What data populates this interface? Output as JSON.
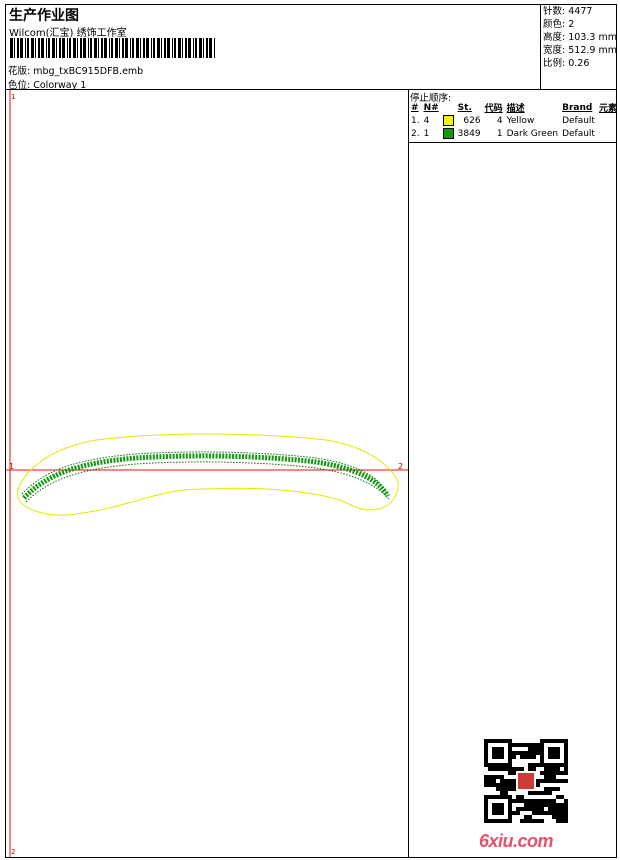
{
  "header": {
    "title": "生产作业图",
    "company": "Wilcom(汇宝) 绣饰工作室",
    "design_label": "花版:",
    "design_value": "mbg_txBC915DFB.emb",
    "color_label": "色位:",
    "color_value": "Colorway 1"
  },
  "stats": [
    {
      "label": "针数:",
      "value": "4477"
    },
    {
      "label": "颜色:",
      "value": "2"
    },
    {
      "label": "高度:",
      "value": "103.3 mm"
    },
    {
      "label": "宽度:",
      "value": "512.9 mm"
    },
    {
      "label": "比例:",
      "value": "0.26"
    }
  ],
  "stop_sequence": {
    "title": "停止顺序:",
    "columns": [
      "#",
      "N#",
      "St.",
      "代码",
      "描述",
      "Brand",
      "元素"
    ],
    "rows": [
      {
        "idx": "1.",
        "n": "4",
        "color": "#f5f500",
        "st": "626",
        "code": "4",
        "desc": "Yellow",
        "brand": "Default"
      },
      {
        "idx": "2.",
        "n": "1",
        "color": "#119a11",
        "st": "3849",
        "code": "1",
        "desc": "Dark Green",
        "brand": "Default"
      }
    ]
  },
  "canvas": {
    "marker_start": "1",
    "marker_end": "2",
    "top_left_marker": "1",
    "bottom_left_marker": "2",
    "outline_color": "#e6e600",
    "stitch_color": "#119a11",
    "guide_color": "#e01010"
  },
  "watermark": {
    "site": "6xiu.com",
    "qr_icon": "qr-code-icon"
  }
}
